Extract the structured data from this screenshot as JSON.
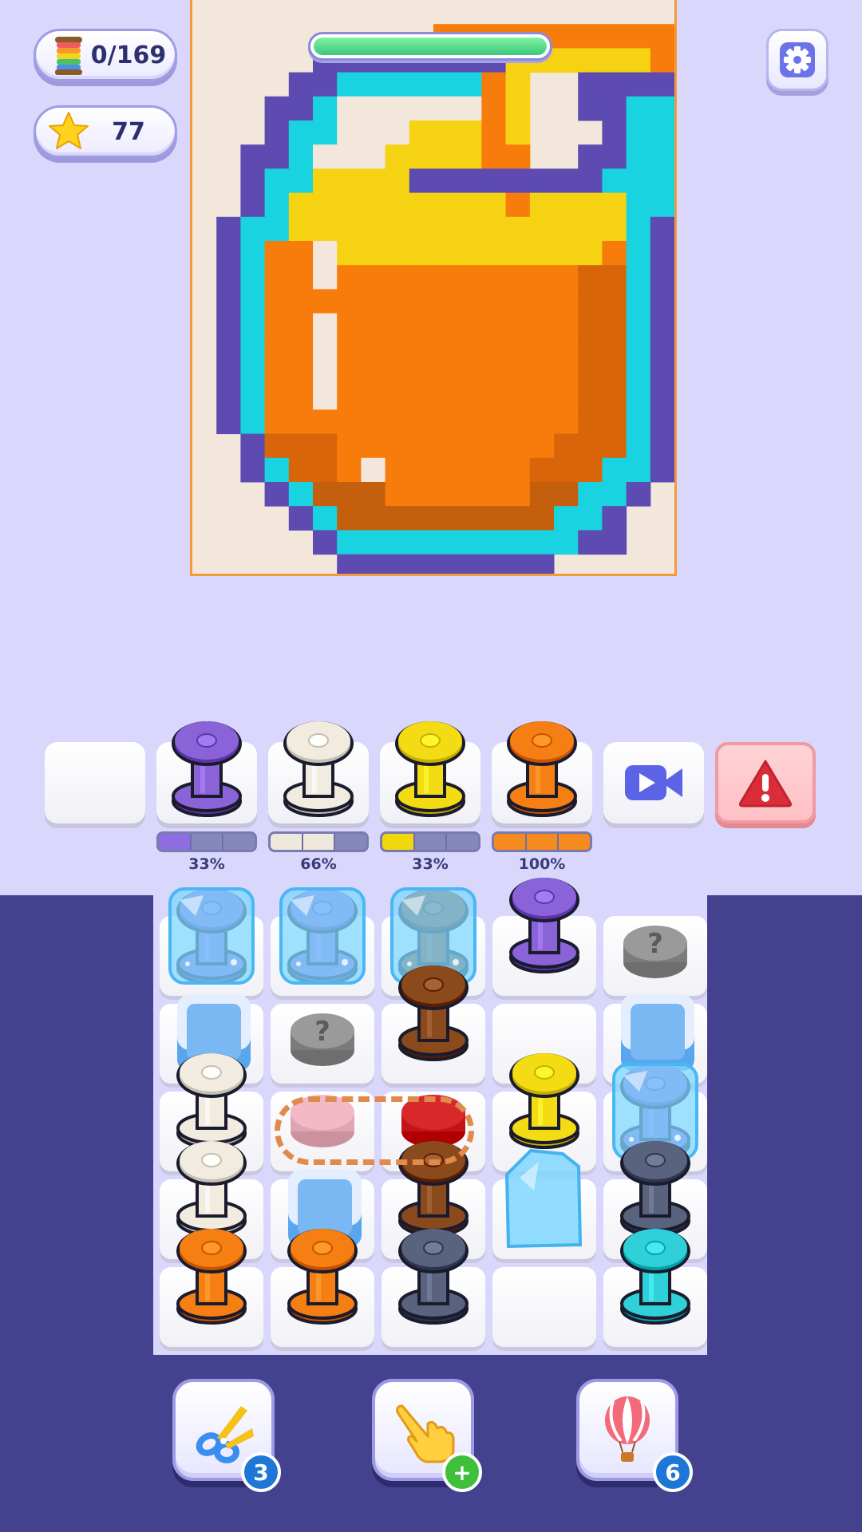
{
  "hud": {
    "spools_count": "0/169",
    "spools_icon": "thread-spool-stack-icon",
    "stars_count": "77",
    "stars_icon": "star-icon",
    "settings_icon": "gear-icon"
  },
  "picture": {
    "subject_icon": "knitted-pixel-orange-juice-icon",
    "progress": 0.05
  },
  "queue": {
    "slots": [
      {
        "kind": "empty"
      },
      {
        "kind": "spool",
        "color": "#8a63d8",
        "label": "33%",
        "filled": 1,
        "total": 3,
        "fill_color": "#8c6ee0"
      },
      {
        "kind": "spool",
        "color": "#f1ebe0",
        "label": "66%",
        "filled": 2,
        "total": 3,
        "fill_color": "#efe8dd"
      },
      {
        "kind": "spool",
        "color": "#f4dc14",
        "label": "33%",
        "filled": 1,
        "total": 3,
        "fill_color": "#f0d80c"
      },
      {
        "kind": "spool",
        "color": "#f57f12",
        "label": "100%",
        "filled": 3,
        "total": 3,
        "fill_color": "#f48a20"
      },
      {
        "kind": "video",
        "icon": "video-camera-icon"
      },
      {
        "kind": "alert",
        "icon": "warning-triangle-icon"
      }
    ]
  },
  "board": {
    "rows": [
      [
        "frozen-yellow",
        "frozen-yellow-broken",
        "brown-frozen",
        "purple",
        "mystery"
      ],
      [
        "ice-block",
        "mystery",
        "brown",
        "empty",
        "ice-block-blue"
      ],
      [
        "cream",
        "pink-linked",
        "red-linked",
        "yellow",
        "purple-frozen"
      ],
      [
        "cream",
        "blue-block",
        "brown",
        "ice-shard",
        "slate"
      ],
      [
        "orange",
        "orange",
        "slate",
        "empty",
        "cyan"
      ]
    ],
    "colors": {
      "purple": "#8a63d8",
      "cream": "#f1ebe0",
      "yellow": "#f4dc14",
      "orange": "#f57f12",
      "brown": "#8b4a1c",
      "slate": "#59637e",
      "cyan": "#2fd0d8",
      "pink": "#f4b9c6",
      "red": "#d8282c",
      "gray": "#8e8e8e"
    }
  },
  "boosters": [
    {
      "icon": "scissors-icon",
      "count": "3",
      "badge": "blue"
    },
    {
      "icon": "pointing-hand-icon",
      "count": "+",
      "badge": "green"
    },
    {
      "icon": "hot-air-balloon-icon",
      "count": "6",
      "badge": "blue"
    }
  ]
}
